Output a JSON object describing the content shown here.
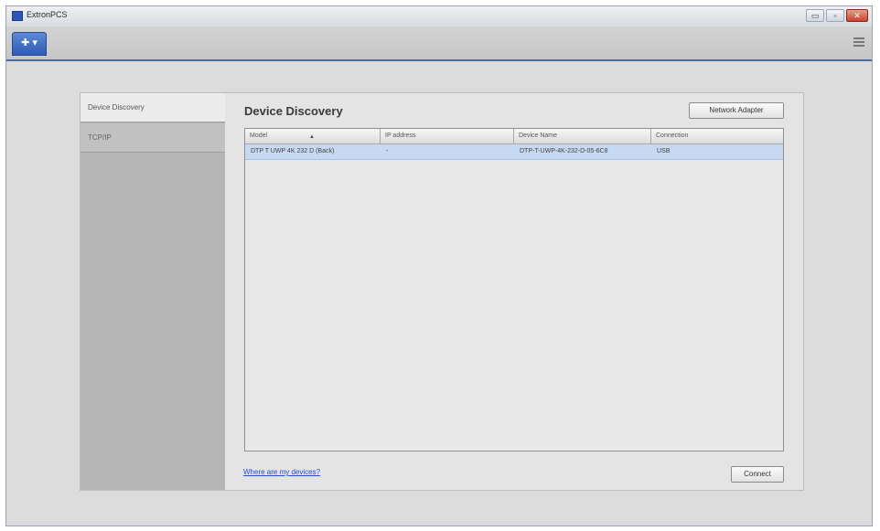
{
  "window": {
    "title": "ExtronPCS",
    "minimize_label": "▭",
    "restore_label": "▫",
    "close_label": "✕"
  },
  "toolbar": {
    "menu_icon": "add-menu-icon",
    "menu_label": "✚ ▾",
    "overflow_icon": "hamburger-menu-icon"
  },
  "sidebar": {
    "items": [
      {
        "label": "Device Discovery"
      },
      {
        "label": "TCP/IP"
      }
    ]
  },
  "main": {
    "heading": "Device Discovery",
    "network_adapter_label": "Network Adapter",
    "table": {
      "columns": [
        "Model",
        "IP address",
        "Device Name",
        "Connection"
      ],
      "sort_indicator": "▲",
      "rows": [
        {
          "model": "DTP T UWP 4K 232 D (Back)",
          "ip": "-",
          "device_name": "DTP-T-UWP-4K-232-D-05-6C8",
          "connection": "USB"
        }
      ]
    },
    "help_link": "Where are my devices?",
    "connect_label": "Connect"
  },
  "colors": {
    "accent": "#2e5ab3",
    "selected_row": "#c6d9f0",
    "link": "#2a4bd0"
  }
}
